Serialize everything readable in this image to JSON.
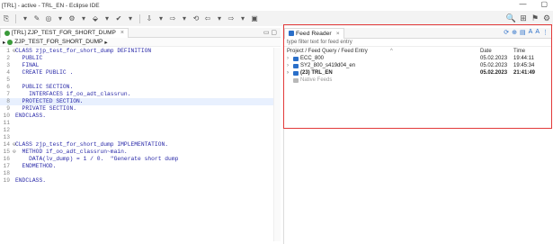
{
  "window": {
    "title": "[TRL] - active - TRL_EN - Eclipse IDE",
    "minimize": "—",
    "restore": "▢"
  },
  "toolbar": {
    "icons": [
      "⎘",
      "▾",
      "✎",
      "◎",
      "▾",
      "⚙",
      "▾",
      "⬙",
      "▾",
      "✔",
      "▾",
      "⇩",
      "▾",
      "⇨",
      "▾",
      "⟲",
      "⇦",
      "▾",
      "⇨",
      "▾",
      "▣"
    ],
    "perspective_icons": [
      "🔍",
      "⊞",
      "⚑",
      "⚙"
    ]
  },
  "editor": {
    "tab_label": "[TRL] ZJP_TEST_FOR_SHORT_DUMP",
    "breadcrumb": "ZJP_TEST_FOR_SHORT_DUMP",
    "lines": [
      {
        "n": "1",
        "fold": "⊖",
        "text": "CLASS zjp_test_for_short_dump DEFINITION"
      },
      {
        "n": "2",
        "fold": "",
        "text": "  PUBLIC"
      },
      {
        "n": "3",
        "fold": "",
        "text": "  FINAL"
      },
      {
        "n": "4",
        "fold": "",
        "text": "  CREATE PUBLIC ."
      },
      {
        "n": "5",
        "fold": "",
        "text": ""
      },
      {
        "n": "6",
        "fold": "",
        "text": "  PUBLIC SECTION."
      },
      {
        "n": "7",
        "fold": "",
        "text": "    INTERFACES if_oo_adt_classrun."
      },
      {
        "n": "8",
        "fold": "",
        "text": "  PROTECTED SECTION."
      },
      {
        "n": "9",
        "fold": "",
        "text": "  PRIVATE SECTION."
      },
      {
        "n": "10",
        "fold": "",
        "text": "ENDCLASS."
      },
      {
        "n": "11",
        "fold": "",
        "text": ""
      },
      {
        "n": "12",
        "fold": "",
        "text": ""
      },
      {
        "n": "13",
        "fold": "",
        "text": ""
      },
      {
        "n": "14",
        "fold": "⊖",
        "text": "CLASS zjp_test_for_short_dump IMPLEMENTATION."
      },
      {
        "n": "15",
        "fold": "⊖",
        "text": "  METHOD if_oo_adt_classrun~main."
      },
      {
        "n": "16",
        "fold": "",
        "text": "    DATA(lv_dump) = 1 / 0.  \"Generate short dump"
      },
      {
        "n": "17",
        "fold": "",
        "text": "  ENDMETHOD."
      },
      {
        "n": "18",
        "fold": "",
        "text": ""
      },
      {
        "n": "19",
        "fold": "",
        "text": "ENDCLASS."
      }
    ]
  },
  "feed": {
    "tab_label": "Feed Reader",
    "filter_placeholder": "type filter text for feed entry",
    "col_name": "Project / Feed Query / Feed Entry",
    "col_date": "Date",
    "col_time": "Time",
    "rows": [
      {
        "name": "ECC_800",
        "date": "05.02.2023",
        "time": "19:44:11",
        "bold": false
      },
      {
        "name": "SY2_800_s419d04_en",
        "date": "05.02.2023",
        "time": "19:45:34",
        "bold": false
      },
      {
        "name": "(23) TRL_EN",
        "date": "05.02.2023",
        "time": "21:41:49",
        "bold": true
      },
      {
        "name": "Native Feeds",
        "date": "",
        "time": "",
        "bold": false
      }
    ]
  }
}
